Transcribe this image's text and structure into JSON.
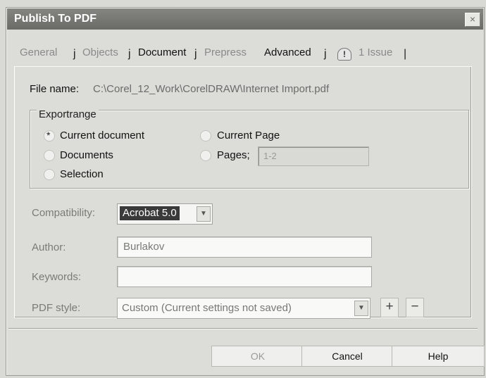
{
  "window": {
    "title": "Publish To PDF",
    "close_label": "×"
  },
  "tabs": [
    {
      "label": "General",
      "dim": true
    },
    {
      "label": "Objects",
      "dim": true
    },
    {
      "label": "Document",
      "dim": false
    },
    {
      "label": "Prepress",
      "dim": true
    },
    {
      "label": "Advanced",
      "dim": false
    },
    {
      "label": "1 Issue",
      "dim": true
    }
  ],
  "tab_separators": [
    "j",
    "j",
    "j",
    "j",
    "|"
  ],
  "warning_icon": "!",
  "file": {
    "label": "File name:",
    "value": "C:\\Corel_12_Work\\CorelDRAW\\Internet Import.pdf"
  },
  "export_range": {
    "legend": "Exportrange",
    "options": [
      {
        "label": "Current document",
        "checked": true
      },
      {
        "label": "Documents",
        "checked": false
      },
      {
        "label": "Selection",
        "checked": false
      },
      {
        "label": "Current Page",
        "checked": false
      },
      {
        "label": "Pages;",
        "checked": false
      }
    ],
    "pages_value": "1-2"
  },
  "compatibility": {
    "label": "Compatibility:",
    "value": "Acrobat 5.0"
  },
  "author": {
    "label": "Author:",
    "value": "Burlakov"
  },
  "keywords": {
    "label": "Keywords:",
    "value": ""
  },
  "pdf_style": {
    "label": "PDF style:",
    "value": "Custom (Current settings not saved)",
    "add_label": "+",
    "remove_label": "−"
  },
  "buttons": {
    "ok": "OK",
    "cancel": "Cancel",
    "help": "Help"
  },
  "colors": {
    "titlebar": "#6f6f6b",
    "dialog_bg": "#dcdcd9",
    "selection": "#3a3a3a"
  },
  "icons": {
    "close": "close-icon",
    "warning": "warning-icon",
    "dropdown": "chevron-down-icon",
    "add": "plus-icon",
    "remove": "minus-icon"
  }
}
